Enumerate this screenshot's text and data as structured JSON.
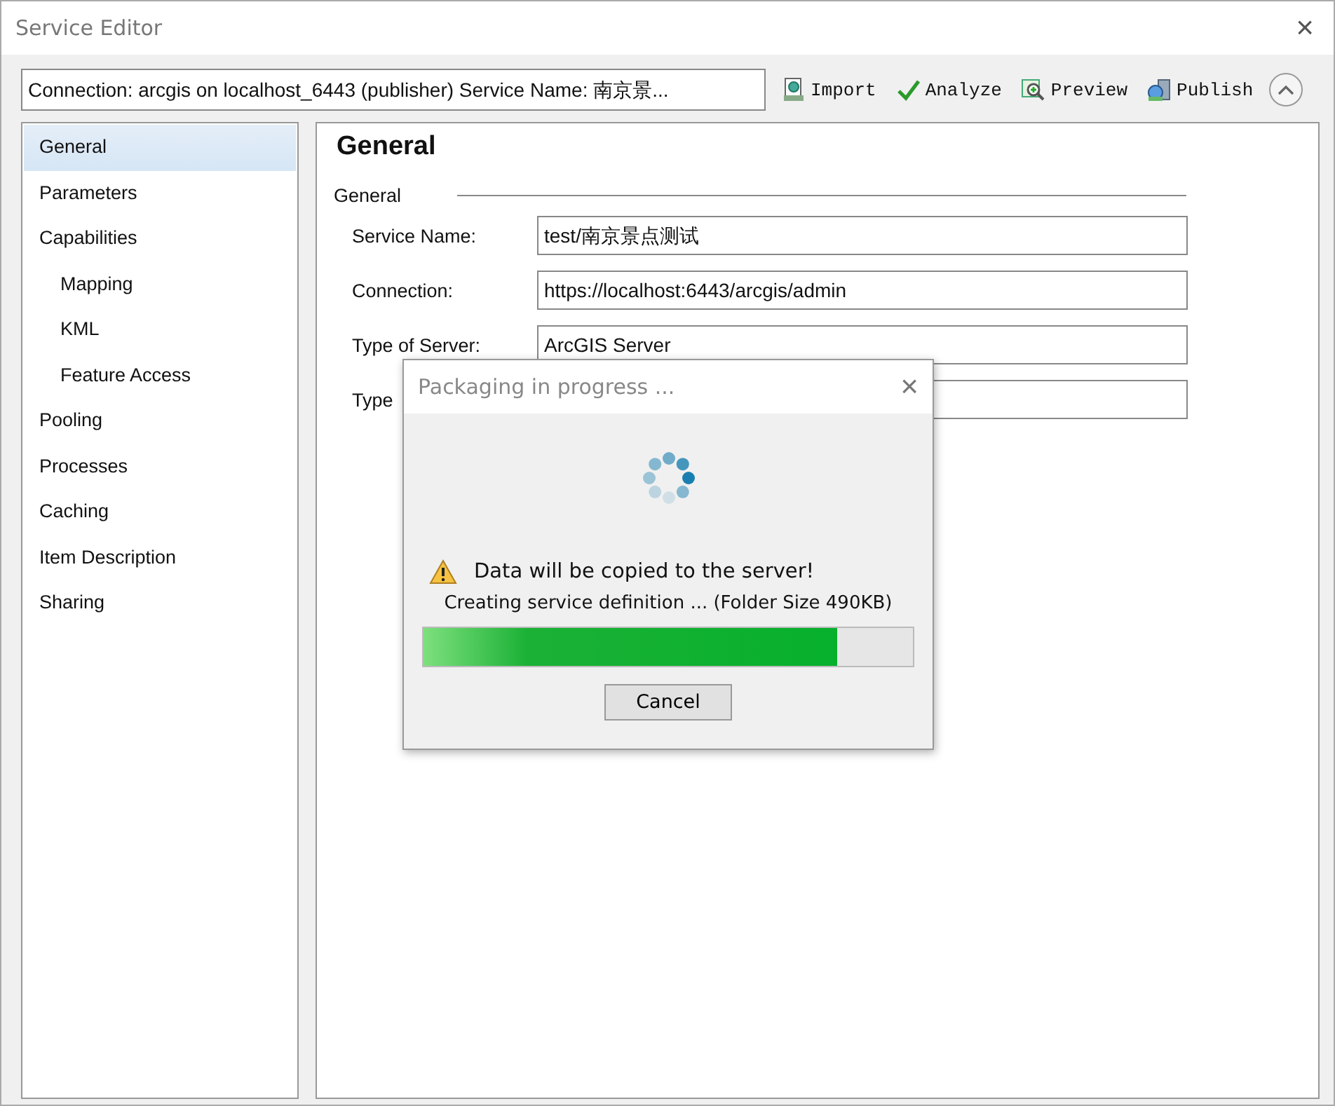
{
  "window": {
    "title": "Service Editor",
    "close": "×"
  },
  "toolbar": {
    "summary": "Connection: arcgis on localhost_6443 (publisher)   Service Name: 南京景...",
    "buttons": [
      {
        "label": "Import",
        "kind": "import"
      },
      {
        "label": "Analyze",
        "kind": "analyze"
      },
      {
        "label": "Preview",
        "kind": "preview"
      },
      {
        "label": "Publish",
        "kind": "publish"
      }
    ]
  },
  "sidebar": {
    "items": [
      {
        "label": "General",
        "selected": true
      },
      {
        "label": "Parameters",
        "selected": false
      },
      {
        "label": "Capabilities",
        "selected": false,
        "children": [
          {
            "label": "Mapping",
            "selected": false
          },
          {
            "label": "KML",
            "selected": false
          },
          {
            "label": "Feature Access",
            "selected": false
          }
        ]
      },
      {
        "label": "Pooling",
        "selected": false
      },
      {
        "label": "Processes",
        "selected": false
      },
      {
        "label": "Caching",
        "selected": false
      },
      {
        "label": "Item Description",
        "selected": false
      },
      {
        "label": "Sharing",
        "selected": false
      }
    ]
  },
  "panel": {
    "title": "General",
    "group": "General",
    "fields": [
      {
        "label": "Service Name:",
        "value": "test/南京景点测试"
      },
      {
        "label": "Connection:",
        "value": "https://localhost:6443/arcgis/admin"
      },
      {
        "label": "Type of Server:",
        "value": "ArcGIS Server"
      },
      {
        "label": "Type"
      }
    ]
  },
  "dialog": {
    "title": "Packaging in progress ...",
    "close": "×",
    "warning": "Data will be copied to the server!",
    "status": "Creating service definition ... (Folder Size 490KB)",
    "progress": {
      "level": 0.846
    },
    "button": "Cancel"
  }
}
